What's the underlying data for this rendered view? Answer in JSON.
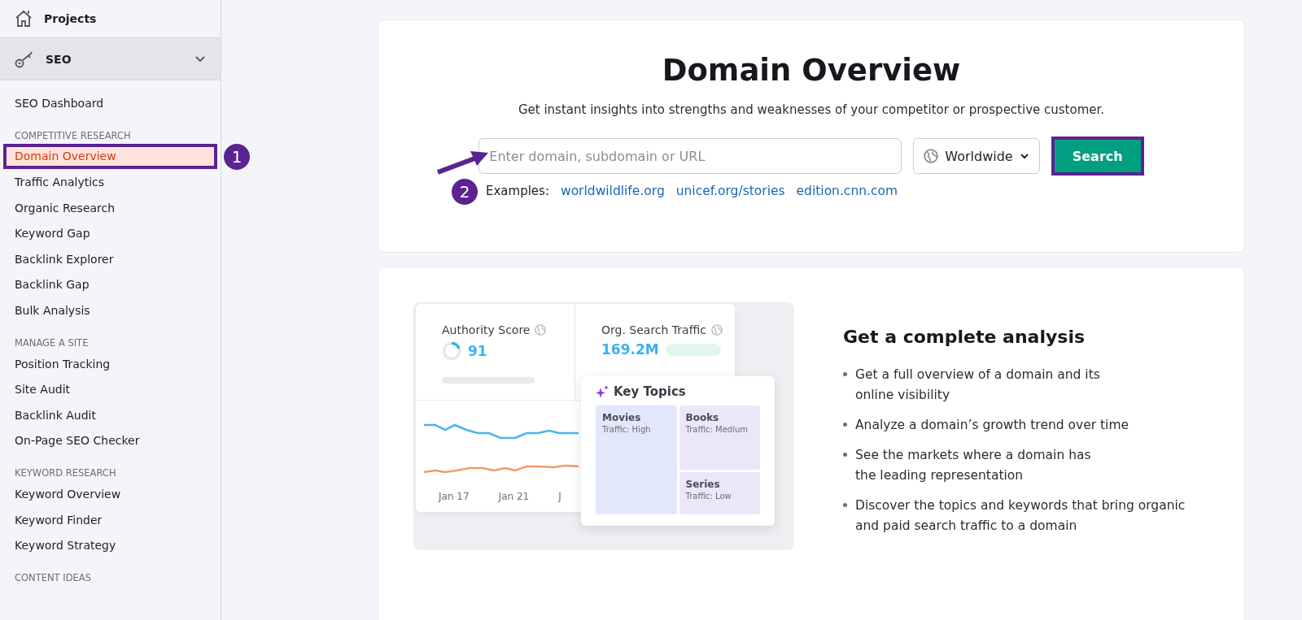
{
  "sidebar": {
    "projects": {
      "label": "Projects"
    },
    "module": {
      "label": "SEO",
      "expanded": true
    },
    "sections": [
      {
        "items": [
          {
            "label": "SEO Dashboard",
            "selected": false
          }
        ]
      },
      {
        "title": "COMPETITIVE RESEARCH",
        "items": [
          {
            "label": "Domain Overview",
            "selected": true,
            "annotation": "1"
          },
          {
            "label": "Traffic Analytics",
            "selected": false
          },
          {
            "label": "Organic Research",
            "selected": false
          },
          {
            "label": "Keyword Gap",
            "selected": false
          },
          {
            "label": "Backlink Explorer",
            "selected": false
          },
          {
            "label": "Backlink Gap",
            "selected": false
          },
          {
            "label": "Bulk Analysis",
            "selected": false
          }
        ]
      },
      {
        "title": "MANAGE A SITE",
        "items": [
          {
            "label": "Position Tracking",
            "selected": false
          },
          {
            "label": "Site Audit",
            "selected": false
          },
          {
            "label": "Backlink Audit",
            "selected": false
          },
          {
            "label": "On-Page SEO Checker",
            "selected": false
          }
        ]
      },
      {
        "title": "KEYWORD RESEARCH",
        "items": [
          {
            "label": "Keyword Overview",
            "selected": false
          },
          {
            "label": "Keyword Finder",
            "selected": false
          },
          {
            "label": "Keyword Strategy",
            "selected": false
          }
        ]
      },
      {
        "title": "CONTENT IDEAS"
      }
    ]
  },
  "search_card": {
    "title": "Domain Overview",
    "subtitle": "Get instant insights into strengths and weaknesses of your competitor or prospective customer.",
    "input": {
      "placeholder": "Enter domain, subdomain or URL"
    },
    "region": "Worldwide",
    "button": {
      "label": "Search",
      "annotated": true
    },
    "examples_label": "Examples:",
    "examples_annotation": "2",
    "examples": [
      "worldwildlife.org",
      "unicef.org/stories",
      "edition.cnn.com"
    ]
  },
  "feature_card": {
    "illustration": {
      "authority_label": "Authority Score",
      "authority_value": "91",
      "traffic_label": "Org. Search Traffic",
      "traffic_value": "169.2M",
      "dates": [
        "Jan 17",
        "Jan 21",
        "J"
      ],
      "key_topics_title": "Key Topics",
      "topics": [
        {
          "name": "Movies",
          "traffic": "Traffic: High"
        },
        {
          "name": "Books",
          "traffic": "Traffic: Medium"
        },
        {
          "name": "Series",
          "traffic": "Traffic: Low"
        }
      ]
    },
    "heading": "Get a complete analysis",
    "bullets": [
      [
        "Get a full overview of a domain and its",
        "online visibility"
      ],
      [
        "Analyze a domain’s growth trend over time"
      ],
      [
        "See the markets where a domain has",
        "the leading representation"
      ],
      [
        "Discover the topics and keywords that bring organic",
        "and paid search traffic to a domain"
      ]
    ]
  }
}
